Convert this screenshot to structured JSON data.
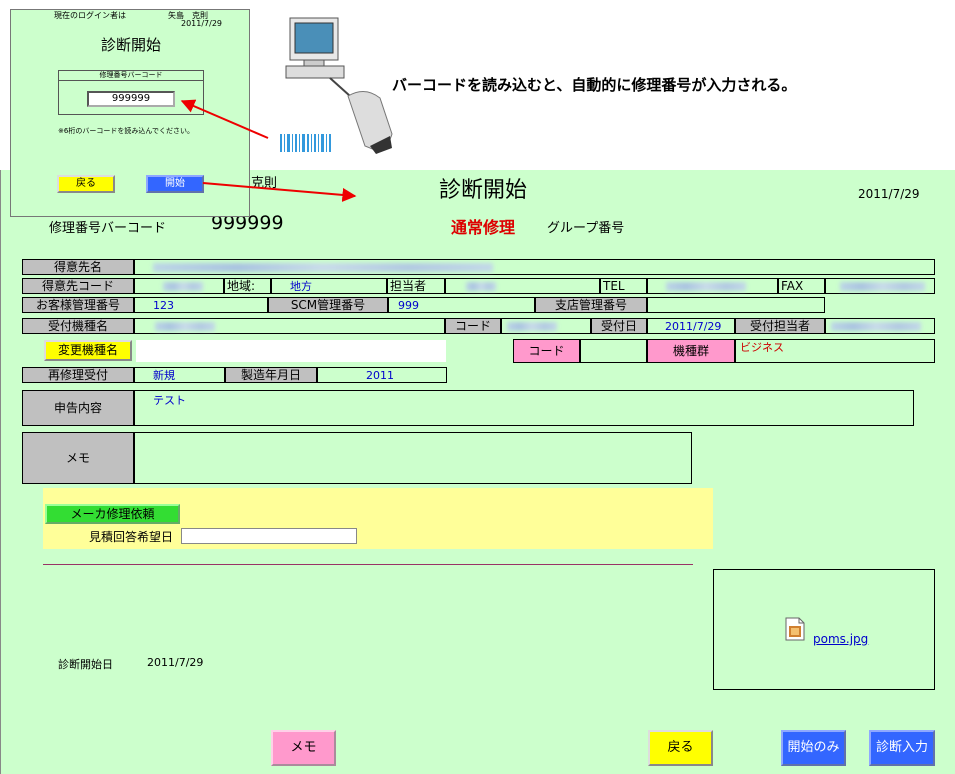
{
  "popup": {
    "login_label": "現在のログイン者は",
    "login_user": "矢島　克則",
    "date": "2011/7/29",
    "title": "診断開始",
    "fieldset_label": "修理番号バーコード",
    "input_value": "999999",
    "note": "※6桁のバーコードを読み込んでください。",
    "back_label": "戻る",
    "start_label": "開始"
  },
  "callout": {
    "text": "バーコードを読み込むと、自動的に修理番号が入力される。"
  },
  "header": {
    "user_fragment": "克則",
    "title": "診断開始",
    "date": "2011/7/29",
    "barcode_label": "修理番号バーコード",
    "repair_number": "999999",
    "repair_type": "通常修理",
    "group_label": "グループ番号"
  },
  "form": {
    "customer_name_label": "得意先名",
    "customer_code_label": "得意先コード",
    "region_label": "地域:",
    "region_value": "地方",
    "staff_label": "担当者",
    "tel_label": "TEL",
    "fax_label": "FAX",
    "cust_mgmt_label": "お客様管理番号",
    "cust_mgmt_value": "123",
    "scm_label": "SCM管理番号",
    "scm_value": "999",
    "branch_label": "支店管理番号",
    "model_label": "受付機種名",
    "code_label": "コード",
    "recv_date_label": "受付日",
    "recv_date_value": "2011/7/29",
    "recv_staff_label": "受付担当者",
    "change_model_label": "変更機種名",
    "code2_label": "コード",
    "model_group_label": "機種群",
    "model_group_value": "ビジネス",
    "rerepair_label": "再修理受付",
    "rerepair_value": "新規",
    "mfg_date_label": "製造年月日",
    "mfg_date_value": "2011",
    "report_label": "申告内容",
    "report_value": "テスト",
    "memo_label": "メモ"
  },
  "maker": {
    "button_label": "メーカ修理依頼",
    "estimate_label": "見積回答希望日",
    "estimate_value": ""
  },
  "footer": {
    "start_date_label": "診断開始日",
    "start_date_value": "2011/7/29",
    "attachment_name": "poms.jpg",
    "memo_button": "メモ",
    "back_button": "戻る",
    "start_only_button": "開始のみ",
    "diag_input_button": "診断入力"
  }
}
